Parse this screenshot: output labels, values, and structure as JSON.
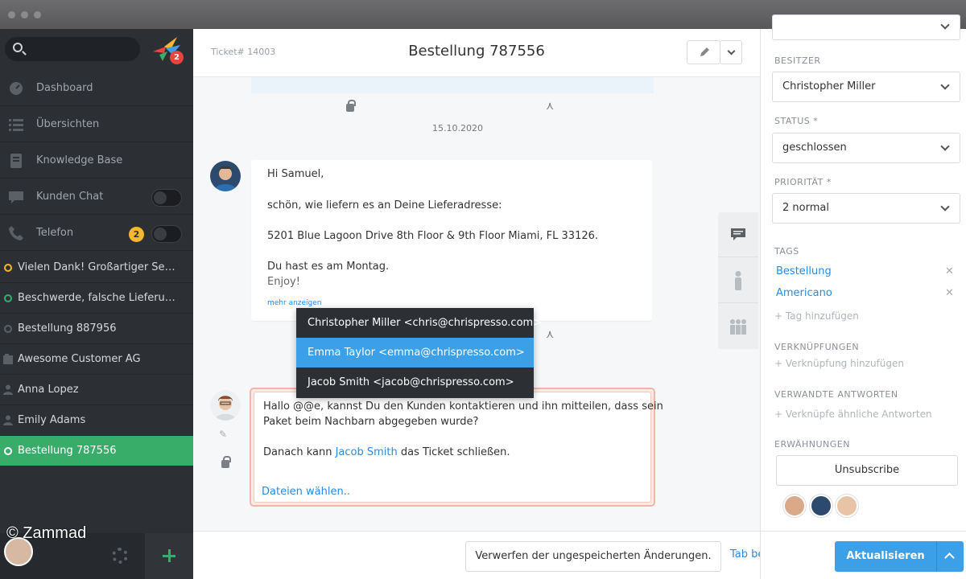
{
  "sidebar": {
    "logo_badge": "2",
    "nav": [
      {
        "label": "Dashboard"
      },
      {
        "label": "Übersichten"
      },
      {
        "label": "Knowledge Base"
      },
      {
        "label": "Kunden Chat"
      },
      {
        "label": "Telefon",
        "badge": "2"
      }
    ],
    "tasks": [
      {
        "label": "Vielen Dank! Großartiger Service!",
        "color": "#f8b62e"
      },
      {
        "label": "Beschwerde, falsche Lieferung ...",
        "color": "#38ad69"
      },
      {
        "label": "Bestellung 887956",
        "color": "#5b6066"
      },
      {
        "label": "Awesome Customer AG"
      },
      {
        "label": "Anna Lopez"
      },
      {
        "label": "Emily Adams"
      },
      {
        "label": "Bestellung 787556",
        "active": true
      }
    ],
    "watermark": "© Zammad"
  },
  "header": {
    "ticket_number": "Ticket# 14003",
    "title": "Bestellung 787556"
  },
  "timeline": {
    "date": "15.10.2020",
    "article": {
      "lines": [
        "Hi Samuel,",
        "schön, wie liefern es an Deine Lieferadresse:",
        "5201 Blue Lagoon Drive 8th Floor & 9th Floor Miami, FL 33126.",
        "Du hast es am Montag.",
        "Enjoy!"
      ],
      "more": "mehr anzeigen"
    }
  },
  "mention_dropdown": [
    {
      "label": "Christopher Miller <chris@chrispresso.com>"
    },
    {
      "label": "Emma Taylor <emma@chrispresso.com>",
      "selected": true
    },
    {
      "label": "Jacob Smith <jacob@chrispresso.com>"
    }
  ],
  "composer": {
    "line1": "Hallo @@e, kannst Du den Kunden kontaktieren und ihn mitteilen, dass sein",
    "line2": "Paket beim Nachbarn abgegeben wurde?",
    "line3_prefix": "Danach kann ",
    "line3_mention": "Jacob Smith",
    "line3_suffix": " das Ticket schließen.",
    "file_link": "Dateien wählen.."
  },
  "footer": {
    "discard": "Verwerfen der ungespeicherten Änderungen.",
    "keep_tab": "Tab beibehalten",
    "update": "Aktualisieren"
  },
  "right_panel": {
    "owner_label": "BESITZER",
    "owner_value": "Christopher Miller",
    "status_label": "STATUS *",
    "status_value": "geschlossen",
    "priority_label": "PRIORITÄT *",
    "priority_value": "2 normal",
    "tags_label": "TAGS",
    "tags": [
      "Bestellung",
      "Americano"
    ],
    "add_tag": "+ Tag hinzufügen",
    "links_label": "VERKNÜPFUNGEN",
    "add_link": "+ Verknüpfung hinzufügen",
    "related_label": "VERWANDTE ANTWORTEN",
    "add_related": "+ Verknüpfe ähnliche Antworten",
    "mentions_label": "ERWÄHNUNGEN",
    "unsubscribe": "Unsubscribe"
  },
  "colors": {
    "accent": "#3ca0e8",
    "active_green": "#38ad69",
    "sidebar_bg": "#2c3035"
  }
}
